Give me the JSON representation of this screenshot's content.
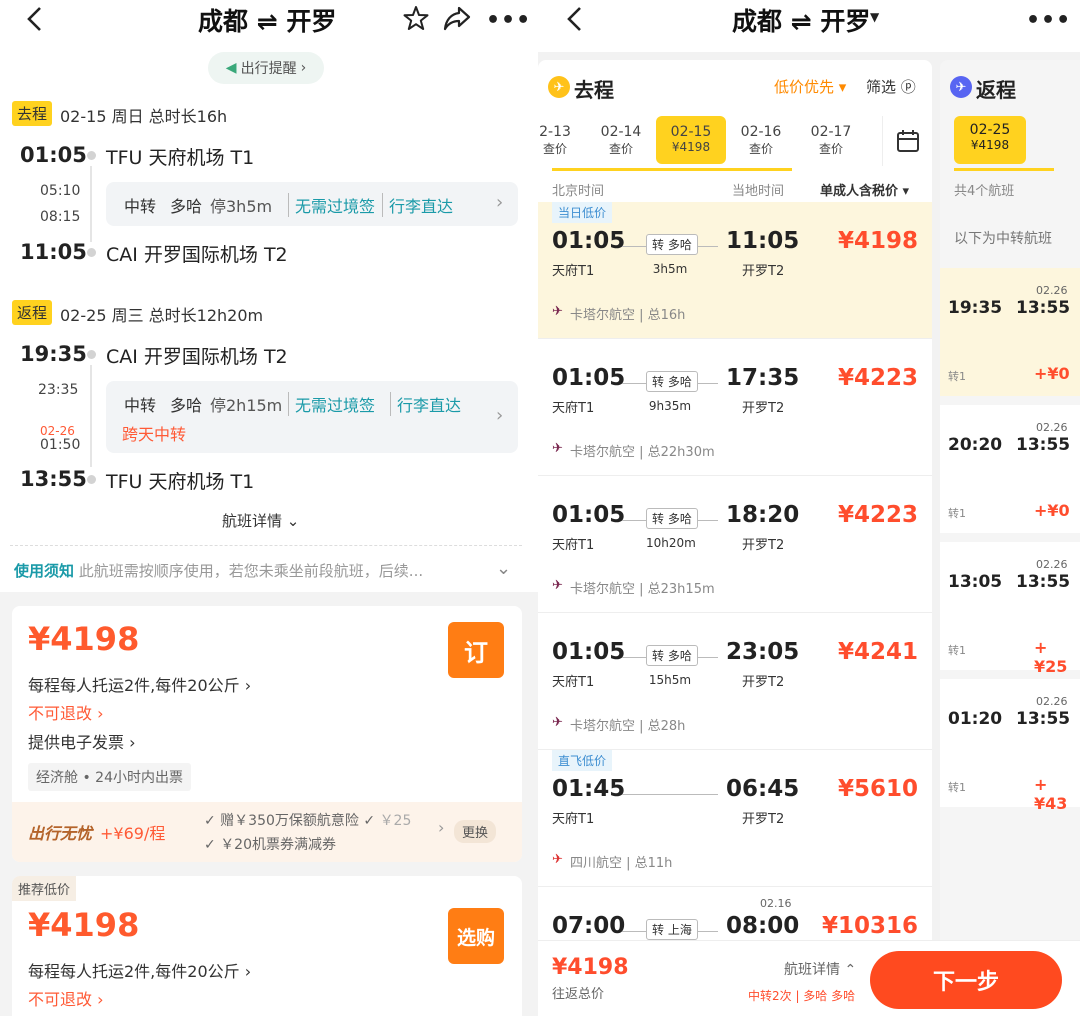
{
  "left": {
    "header": {
      "title": "成都 ⇌ 开罗"
    },
    "reminder": "出行提醒",
    "outbound": {
      "tag": "去程",
      "info": "02-15 周日 总时长16h",
      "dep_time": "01:05",
      "dep_station": "TFU 天府机场 T1",
      "transfer_arr": "05:10",
      "transfer_dep": "08:15",
      "transfer_label": "中转",
      "transfer_city": "多哈",
      "transfer_stay": "停3h5m",
      "visa": "无需过境签",
      "baggage": "行李直达",
      "arr_time": "11:05",
      "arr_station": "CAI 开罗国际机场 T2"
    },
    "return": {
      "tag": "返程",
      "info": "02-25 周三 总时长12h20m",
      "dep_time": "19:35",
      "dep_station": "CAI 开罗国际机场 T2",
      "transfer_arr": "23:35",
      "transfer_date": "02-26",
      "transfer_dep": "01:50",
      "transfer_label": "中转",
      "transfer_city": "多哈",
      "transfer_stay": "停2h15m",
      "visa": "无需过境签",
      "baggage": "行李直达",
      "overnight": "跨天中转",
      "arr_time": "13:55",
      "arr_station": "TFU 天府机场 T1"
    },
    "flight_details": "航班详情",
    "notice_title": "使用须知",
    "notice_text": "此航班需按顺序使用，若您未乘坐前段航班，后续...",
    "offer1": {
      "price": "¥4198",
      "book": "订",
      "baggage": "每程每人托运2件,每件20公斤",
      "refund": "不可退改",
      "invoice": "提供电子发票",
      "cabin": "经济舱 • 24小时内出票",
      "addon_title": "出行无忧",
      "addon_price": "+¥69/程",
      "addon_item1": "赠￥350万保额航意险",
      "addon_item1b": "￥25",
      "addon_item2": "￥20机票券满减券",
      "addon_change": "更换"
    },
    "offer2": {
      "tag": "推荐低价",
      "price": "¥4198",
      "book": "选购",
      "baggage": "每程每人托运2件,每件20公斤",
      "refund": "不可退改"
    }
  },
  "right": {
    "header": {
      "title": "成都 ⇌ 开罗"
    },
    "outbound_label": "去程",
    "sort_label": "低价优先",
    "filter_label": "筛选",
    "dates": [
      {
        "date": "2-13",
        "sub": "查价"
      },
      {
        "date": "02-14",
        "sub": "查价"
      },
      {
        "date": "02-15",
        "sub": "¥4198"
      },
      {
        "date": "02-16",
        "sub": "查价"
      },
      {
        "date": "02-17",
        "sub": "查价"
      }
    ],
    "col_beijing": "北京时间",
    "col_local": "当地时间",
    "col_price": "单成人含税价",
    "flights": [
      {
        "ribbon": "当日低价",
        "dep": "01:05",
        "arr": "11:05",
        "depst": "天府T1",
        "arrst": "开罗T2",
        "stop": "转 多哈",
        "dur": "3h5m",
        "price": "¥4198",
        "airline": "卡塔尔航空 | 总16h"
      },
      {
        "ribbon": "",
        "dep": "01:05",
        "arr": "17:35",
        "depst": "天府T1",
        "arrst": "开罗T2",
        "stop": "转 多哈",
        "dur": "9h35m",
        "price": "¥4223",
        "airline": "卡塔尔航空 | 总22h30m"
      },
      {
        "ribbon": "",
        "dep": "01:05",
        "arr": "18:20",
        "depst": "天府T1",
        "arrst": "开罗T2",
        "stop": "转 多哈",
        "dur": "10h20m",
        "price": "¥4223",
        "airline": "卡塔尔航空 | 总23h15m"
      },
      {
        "ribbon": "",
        "dep": "01:05",
        "arr": "23:05",
        "depst": "天府T1",
        "arrst": "开罗T2",
        "stop": "转 多哈",
        "dur": "15h5m",
        "price": "¥4241",
        "airline": "卡塔尔航空 | 总28h"
      },
      {
        "ribbon": "直飞低价",
        "dep": "01:45",
        "arr": "06:45",
        "depst": "天府T1",
        "arrst": "开罗T2",
        "stop": "",
        "dur": "",
        "price": "¥5610",
        "airline": "四川航空 | 总11h"
      },
      {
        "ribbon": "",
        "dep": "07:00",
        "arr": "08:00",
        "arr_date": "02.16",
        "depst": "",
        "arrst": "",
        "stop": "转 上海",
        "dur": "",
        "price": "¥10316",
        "airline": ""
      }
    ],
    "return_label": "返程",
    "return_date": {
      "date": "02-25",
      "sub": "¥4198"
    },
    "return_count": "共4个航班",
    "return_note": "以下为中转航班",
    "return_flights": [
      {
        "dep": "19:35",
        "arr": "13:55",
        "date": "02.26",
        "tr": "转1",
        "price": "+¥0"
      },
      {
        "dep": "20:20",
        "arr": "13:55",
        "date": "02.26",
        "tr": "转1",
        "price": "+¥0"
      },
      {
        "dep": "13:05",
        "arr": "13:55",
        "date": "02.26",
        "tr": "转1",
        "price": "+¥25"
      },
      {
        "dep": "01:20",
        "arr": "13:55",
        "date": "02.26",
        "tr": "转1",
        "price": "+¥43"
      }
    ],
    "footer": {
      "price": "¥4198",
      "price_label": "往返总价",
      "details": "航班详情",
      "route": "中转2次 | 多哈 多哈",
      "next": "下一步"
    }
  },
  "colors": {
    "accent": "#ff7d14",
    "price": "#ff4d2d",
    "yellow": "#ffd21f",
    "teal": "#1a9aa8"
  }
}
